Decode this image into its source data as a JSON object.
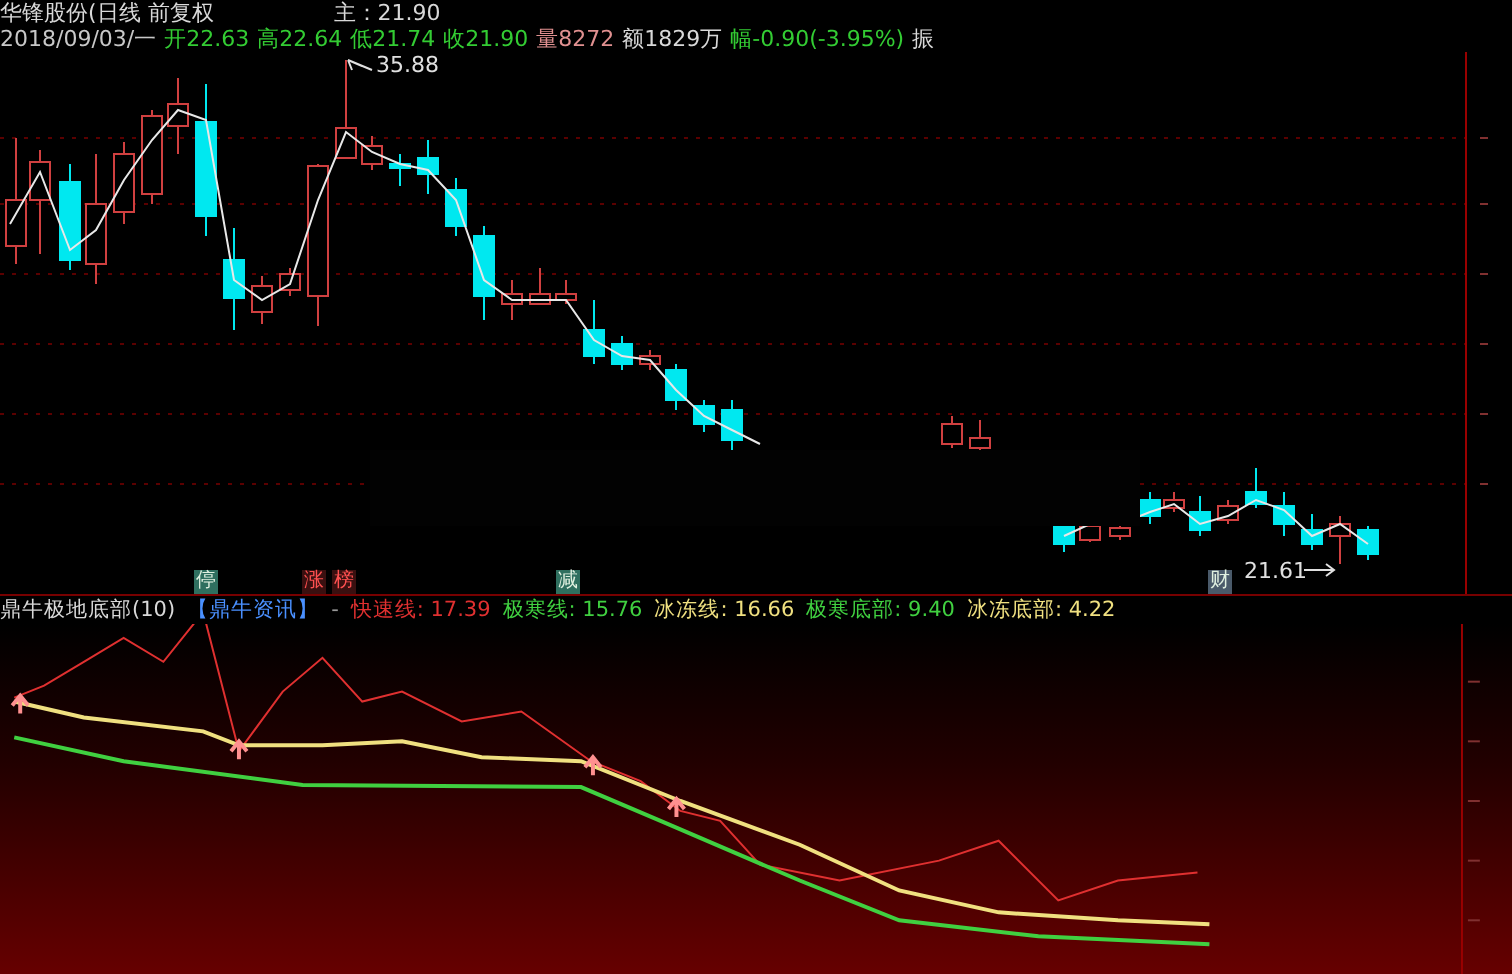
{
  "header": {
    "title": "华锋股份(日线 前复权",
    "main": "主：21.90",
    "date": "2018/09/03/一",
    "quote": [
      {
        "text": "开22.63",
        "color": "#33cc33"
      },
      {
        "text": "高22.64",
        "color": "#33cc33"
      },
      {
        "text": "低21.74",
        "color": "#33cc33"
      },
      {
        "text": "收21.90",
        "color": "#33cc33"
      },
      {
        "text": "量8272",
        "color": "#e09090"
      },
      {
        "text": "额1829万",
        "color": "#d8d8d8"
      },
      {
        "text": "幅-0.90(-3.95%)",
        "color": "#33cc33"
      },
      {
        "text": "振",
        "color": "#d8d8d8"
      }
    ]
  },
  "chart": {
    "high_label": "35.88",
    "low_label": "21.61"
  },
  "markers": [
    {
      "text": "停",
      "color": "#2f6f5f"
    },
    {
      "text": "涨",
      "color": "#3a1010"
    },
    {
      "text": "榜",
      "color": "#3a1010"
    },
    {
      "text": "减",
      "color": "#2f6f5f"
    },
    {
      "text": "财",
      "color": "#4a5a6a"
    }
  ],
  "indicator": {
    "title": "鼎牛极地底部(10)",
    "source": "【鼎牛资讯】",
    "dash": "-",
    "lines": [
      {
        "text": "快速线: 17.39",
        "color": "#e03030"
      },
      {
        "text": "极寒线: 15.76",
        "color": "#40d040"
      },
      {
        "text": "冰冻线: 16.66",
        "color": "#f0e080"
      },
      {
        "text": "极寒底部: 9.40",
        "color": "#40d040"
      },
      {
        "text": "冰冻底部: 4.22",
        "color": "#f0e080"
      }
    ]
  }
}
